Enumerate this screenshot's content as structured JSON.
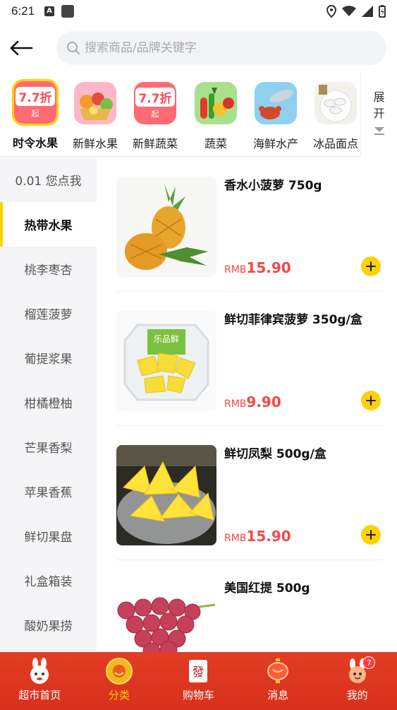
{
  "status_bar": {
    "time": "6:21",
    "indicator": "A"
  },
  "search": {
    "placeholder": "搜索商品/品牌关键字"
  },
  "categories": [
    {
      "label": "时令水果",
      "icon": "discount-7.7-icon",
      "badge_big": "7.7折",
      "badge_small": "起",
      "active": true
    },
    {
      "label": "新鲜水果",
      "icon": "fruit-basket-icon"
    },
    {
      "label": "新鲜蔬菜",
      "icon": "discount-7.7-icon",
      "badge_big": "7.7折",
      "badge_small": "起"
    },
    {
      "label": "蔬菜",
      "icon": "vegetables-icon"
    },
    {
      "label": "海鲜水产",
      "icon": "seafood-icon"
    },
    {
      "label": "冰品面点",
      "icon": "dumplings-icon"
    }
  ],
  "expand": {
    "label_1": "展",
    "label_2": "开"
  },
  "sidebar": {
    "items": [
      {
        "label": "0.01 您点我"
      },
      {
        "label": "热带水果",
        "active": true
      },
      {
        "label": "桃李枣杏"
      },
      {
        "label": "榴莲菠萝"
      },
      {
        "label": "葡提浆果"
      },
      {
        "label": "柑橘橙柚"
      },
      {
        "label": "芒果香梨"
      },
      {
        "label": "苹果香蕉"
      },
      {
        "label": "鲜切果盘"
      },
      {
        "label": "礼盒箱装"
      },
      {
        "label": "酸奶果捞"
      }
    ]
  },
  "products": [
    {
      "name": "香水小菠萝 750g",
      "currency": "RMB",
      "price": "15.90",
      "image": "whole-pineapple"
    },
    {
      "name": "鲜切菲律宾菠萝 350g/盒",
      "currency": "RMB",
      "price": "9.90",
      "image": "boxed-pineapple",
      "box_label": "乐品鲜"
    },
    {
      "name": "鲜切凤梨 500g/盒",
      "currency": "RMB",
      "price": "15.90",
      "image": "pineapple-chunks"
    },
    {
      "name": "美国红提 500g",
      "image": "red-grapes"
    }
  ],
  "tabbar": {
    "items": [
      {
        "label": "超市首页",
        "icon": "rabbit-mascot-icon"
      },
      {
        "label": "分类",
        "icon": "category-icon",
        "active": true
      },
      {
        "label": "购物车",
        "icon": "cart-tile-icon",
        "glyph": "發"
      },
      {
        "label": "消息",
        "icon": "lantern-icon"
      },
      {
        "label": "我的",
        "icon": "profile-mascot-icon",
        "badge": "7"
      }
    ]
  },
  "colors": {
    "accent": "#ffd100",
    "price": "#f04a4a",
    "tabbar": "#e33d24"
  }
}
